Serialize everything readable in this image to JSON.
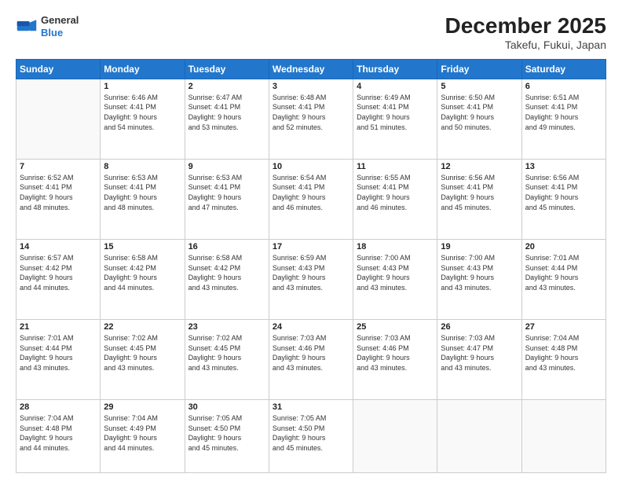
{
  "header": {
    "logo": {
      "line1": "General",
      "line2": "Blue"
    },
    "title": "December 2025",
    "subtitle": "Takefu, Fukui, Japan"
  },
  "weekdays": [
    "Sunday",
    "Monday",
    "Tuesday",
    "Wednesday",
    "Thursday",
    "Friday",
    "Saturday"
  ],
  "weeks": [
    [
      {
        "day": "",
        "info": ""
      },
      {
        "day": "1",
        "info": "Sunrise: 6:46 AM\nSunset: 4:41 PM\nDaylight: 9 hours\nand 54 minutes."
      },
      {
        "day": "2",
        "info": "Sunrise: 6:47 AM\nSunset: 4:41 PM\nDaylight: 9 hours\nand 53 minutes."
      },
      {
        "day": "3",
        "info": "Sunrise: 6:48 AM\nSunset: 4:41 PM\nDaylight: 9 hours\nand 52 minutes."
      },
      {
        "day": "4",
        "info": "Sunrise: 6:49 AM\nSunset: 4:41 PM\nDaylight: 9 hours\nand 51 minutes."
      },
      {
        "day": "5",
        "info": "Sunrise: 6:50 AM\nSunset: 4:41 PM\nDaylight: 9 hours\nand 50 minutes."
      },
      {
        "day": "6",
        "info": "Sunrise: 6:51 AM\nSunset: 4:41 PM\nDaylight: 9 hours\nand 49 minutes."
      }
    ],
    [
      {
        "day": "7",
        "info": "Sunrise: 6:52 AM\nSunset: 4:41 PM\nDaylight: 9 hours\nand 48 minutes."
      },
      {
        "day": "8",
        "info": "Sunrise: 6:53 AM\nSunset: 4:41 PM\nDaylight: 9 hours\nand 48 minutes."
      },
      {
        "day": "9",
        "info": "Sunrise: 6:53 AM\nSunset: 4:41 PM\nDaylight: 9 hours\nand 47 minutes."
      },
      {
        "day": "10",
        "info": "Sunrise: 6:54 AM\nSunset: 4:41 PM\nDaylight: 9 hours\nand 46 minutes."
      },
      {
        "day": "11",
        "info": "Sunrise: 6:55 AM\nSunset: 4:41 PM\nDaylight: 9 hours\nand 46 minutes."
      },
      {
        "day": "12",
        "info": "Sunrise: 6:56 AM\nSunset: 4:41 PM\nDaylight: 9 hours\nand 45 minutes."
      },
      {
        "day": "13",
        "info": "Sunrise: 6:56 AM\nSunset: 4:41 PM\nDaylight: 9 hours\nand 45 minutes."
      }
    ],
    [
      {
        "day": "14",
        "info": "Sunrise: 6:57 AM\nSunset: 4:42 PM\nDaylight: 9 hours\nand 44 minutes."
      },
      {
        "day": "15",
        "info": "Sunrise: 6:58 AM\nSunset: 4:42 PM\nDaylight: 9 hours\nand 44 minutes."
      },
      {
        "day": "16",
        "info": "Sunrise: 6:58 AM\nSunset: 4:42 PM\nDaylight: 9 hours\nand 43 minutes."
      },
      {
        "day": "17",
        "info": "Sunrise: 6:59 AM\nSunset: 4:43 PM\nDaylight: 9 hours\nand 43 minutes."
      },
      {
        "day": "18",
        "info": "Sunrise: 7:00 AM\nSunset: 4:43 PM\nDaylight: 9 hours\nand 43 minutes."
      },
      {
        "day": "19",
        "info": "Sunrise: 7:00 AM\nSunset: 4:43 PM\nDaylight: 9 hours\nand 43 minutes."
      },
      {
        "day": "20",
        "info": "Sunrise: 7:01 AM\nSunset: 4:44 PM\nDaylight: 9 hours\nand 43 minutes."
      }
    ],
    [
      {
        "day": "21",
        "info": "Sunrise: 7:01 AM\nSunset: 4:44 PM\nDaylight: 9 hours\nand 43 minutes."
      },
      {
        "day": "22",
        "info": "Sunrise: 7:02 AM\nSunset: 4:45 PM\nDaylight: 9 hours\nand 43 minutes."
      },
      {
        "day": "23",
        "info": "Sunrise: 7:02 AM\nSunset: 4:45 PM\nDaylight: 9 hours\nand 43 minutes."
      },
      {
        "day": "24",
        "info": "Sunrise: 7:03 AM\nSunset: 4:46 PM\nDaylight: 9 hours\nand 43 minutes."
      },
      {
        "day": "25",
        "info": "Sunrise: 7:03 AM\nSunset: 4:46 PM\nDaylight: 9 hours\nand 43 minutes."
      },
      {
        "day": "26",
        "info": "Sunrise: 7:03 AM\nSunset: 4:47 PM\nDaylight: 9 hours\nand 43 minutes."
      },
      {
        "day": "27",
        "info": "Sunrise: 7:04 AM\nSunset: 4:48 PM\nDaylight: 9 hours\nand 43 minutes."
      }
    ],
    [
      {
        "day": "28",
        "info": "Sunrise: 7:04 AM\nSunset: 4:48 PM\nDaylight: 9 hours\nand 44 minutes."
      },
      {
        "day": "29",
        "info": "Sunrise: 7:04 AM\nSunset: 4:49 PM\nDaylight: 9 hours\nand 44 minutes."
      },
      {
        "day": "30",
        "info": "Sunrise: 7:05 AM\nSunset: 4:50 PM\nDaylight: 9 hours\nand 45 minutes."
      },
      {
        "day": "31",
        "info": "Sunrise: 7:05 AM\nSunset: 4:50 PM\nDaylight: 9 hours\nand 45 minutes."
      },
      {
        "day": "",
        "info": ""
      },
      {
        "day": "",
        "info": ""
      },
      {
        "day": "",
        "info": ""
      }
    ]
  ]
}
